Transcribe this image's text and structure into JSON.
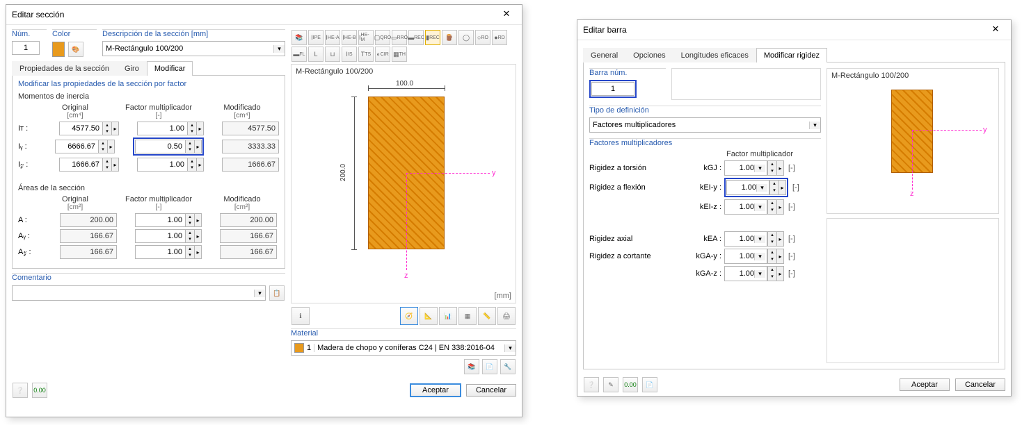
{
  "left": {
    "title": "Editar sección",
    "num_label": "Núm.",
    "num_value": "1",
    "color_label": "Color",
    "desc_label": "Descripción de la sección [mm]",
    "desc_value": "M-Rectángulo 100/200",
    "toolbar_icons": [
      "book-icon",
      "ipe-icon",
      "hea-icon",
      "heb-icon",
      "hem-icon",
      "qro-icon",
      "rro-icon",
      "rec-icon",
      "rec2-icon",
      "timber-icon",
      "pipe-icon",
      "ro-icon",
      "rd-icon",
      "fl-icon",
      "l-icon",
      "u2-icon",
      "is-icon",
      "ts-icon",
      "cir-icon",
      "th-icon",
      "rod-icon"
    ],
    "tabs": [
      "Propiedades de la sección",
      "Giro",
      "Modificar"
    ],
    "active_tab": 2,
    "modify_title": "Modificar las propiedades de la sección por factor",
    "inertia_title": "Momentos de inercia",
    "col_original": "Original",
    "unit_cm4": "[cm⁴]",
    "col_factor": "Factor multiplicador",
    "unit_dash": "[-]",
    "col_modified": "Modificado",
    "rows_inertia": [
      {
        "label": "Iᴛ :",
        "orig": "4577.50",
        "factor": "1.00",
        "mod": "4577.50"
      },
      {
        "label": "Iᵧ :",
        "orig": "6666.67",
        "factor": "0.50",
        "mod": "3333.33"
      },
      {
        "label": "I𝓏 :",
        "orig": "1666.67",
        "factor": "1.00",
        "mod": "1666.67"
      }
    ],
    "areas_title": "Áreas de la sección",
    "unit_cm2": "[cm²]",
    "rows_areas": [
      {
        "label": "A :",
        "orig": "200.00",
        "factor": "1.00",
        "mod": "200.00"
      },
      {
        "label": "Aᵧ :",
        "orig": "166.67",
        "factor": "1.00",
        "mod": "166.67"
      },
      {
        "label": "A𝓏 :",
        "orig": "166.67",
        "factor": "1.00",
        "mod": "166.67"
      }
    ],
    "preview_title": "M-Rectángulo 100/200",
    "dim_w": "100.0",
    "dim_h": "200.0",
    "axis_y": "y",
    "axis_z": "z",
    "unit_mm": "[mm]",
    "material_title": "Material",
    "material_idx": "1",
    "material_text": "Madera de chopo y coníferas C24 | EN 338:2016-04",
    "comment_label": "Comentario",
    "accept": "Aceptar",
    "cancel": "Cancelar"
  },
  "right": {
    "title": "Editar barra",
    "tabs": [
      "General",
      "Opciones",
      "Longitudes eficaces",
      "Modificar rigidez"
    ],
    "active_tab": 3,
    "bar_num_label": "Barra núm.",
    "bar_num_value": "1",
    "type_title": "Tipo de definición",
    "type_value": "Factores multiplicadores",
    "factors_title": "Factores multiplicadores",
    "col_factor": "Factor multiplicador",
    "rows": [
      {
        "label": "Rigidez a torsión",
        "sym": "kGJ :",
        "val": "1.00",
        "unit": "[-]"
      },
      {
        "label": "Rigidez a flexión",
        "sym": "kEI-y :",
        "val": "1.00",
        "unit": "[-]",
        "hl": true
      },
      {
        "label": "",
        "sym": "kEI-z :",
        "val": "1.00",
        "unit": "[-]"
      },
      {
        "spacer": true
      },
      {
        "label": "Rigidez axial",
        "sym": "kEA :",
        "val": "1.00",
        "unit": "[-]"
      },
      {
        "label": "Rigidez a cortante",
        "sym": "kGA-y :",
        "val": "1.00",
        "unit": "[-]"
      },
      {
        "label": "",
        "sym": "kGA-z :",
        "val": "1.00",
        "unit": "[-]"
      }
    ],
    "preview_title": "M-Rectángulo 100/200",
    "axis_y": "y",
    "axis_z": "z",
    "accept": "Aceptar",
    "cancel": "Cancelar"
  }
}
